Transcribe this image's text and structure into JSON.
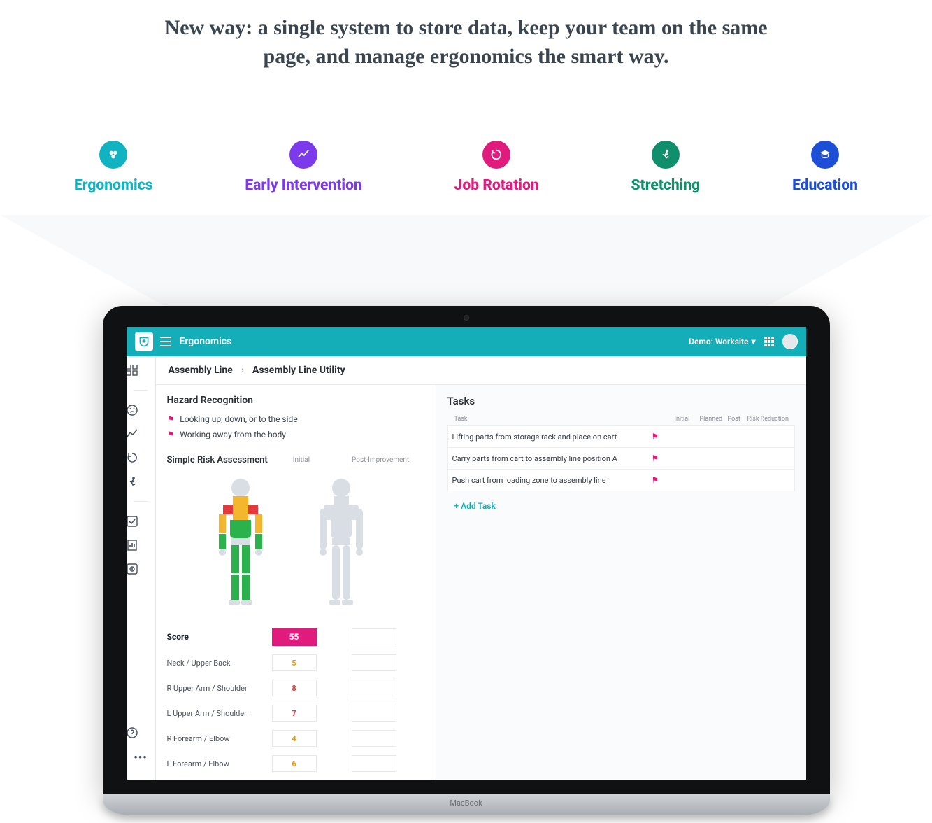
{
  "headline": "New way: a single system to store data, keep your team on the same page, and manage ergonomics the smart way.",
  "features": [
    {
      "label": "Ergonomics",
      "color": "teal"
    },
    {
      "label": "Early Intervention",
      "color": "purple"
    },
    {
      "label": "Job Rotation",
      "color": "pink"
    },
    {
      "label": "Stretching",
      "color": "green"
    },
    {
      "label": "Education",
      "color": "blue"
    }
  ],
  "app": {
    "title": "Ergonomics",
    "workspace": "Demo: Worksite",
    "breadcrumb": {
      "parent": "Assembly Line",
      "current": "Assembly Line Utility"
    },
    "hazard": {
      "title": "Hazard Recognition",
      "items": [
        "Looking up, down, or to the side",
        "Working away from the body"
      ]
    },
    "assessment": {
      "title": "Simple Risk Assessment",
      "col_initial": "Initial",
      "col_post": "Post-Improvement",
      "score_label": "Score",
      "score_value": "55",
      "rows": [
        {
          "label": "Neck / Upper Back",
          "value": "5",
          "cls": "v-orange"
        },
        {
          "label": "R Upper Arm / Shoulder",
          "value": "8",
          "cls": "v-red"
        },
        {
          "label": "L Upper Arm / Shoulder",
          "value": "7",
          "cls": "v-red"
        },
        {
          "label": "R Forearm / Elbow",
          "value": "4",
          "cls": "v-orange"
        },
        {
          "label": "L Forearm / Elbow",
          "value": "6",
          "cls": "v-orange"
        }
      ]
    },
    "tasks": {
      "title": "Tasks",
      "headers": {
        "task": "Task",
        "initial": "Initial",
        "planned": "Planned",
        "post": "Post",
        "risk": "Risk Reduction"
      },
      "items": [
        "Lifting parts from storage rack and place on cart",
        "Carry parts from cart to assembly line position A",
        "Push cart from loading zone to assembly line"
      ],
      "add": "+ Add Task"
    }
  },
  "laptop_label": "MacBook"
}
